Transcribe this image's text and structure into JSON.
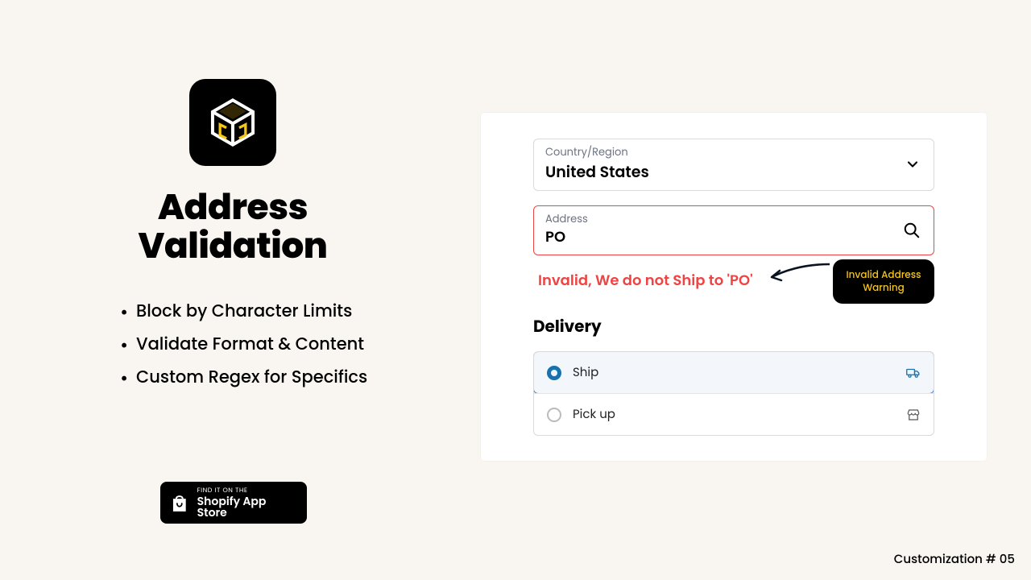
{
  "left": {
    "heading_line1": "Address",
    "heading_line2": "Validation",
    "features": [
      "Block by Character Limits",
      "Validate Format & Content",
      "Custom Regex for Specifics"
    ]
  },
  "store_badge": {
    "small": "FIND IT ON THE",
    "big": "Shopify App Store"
  },
  "form": {
    "country_label": "Country/Region",
    "country_value": "United States",
    "address_label": "Address",
    "address_value": "PO",
    "error_message": "Invalid, We do not Ship to 'PO'",
    "delivery_title": "Delivery",
    "options": [
      {
        "label": "Ship",
        "selected": true,
        "icon": "truck"
      },
      {
        "label": "Pick up",
        "selected": false,
        "icon": "store"
      }
    ]
  },
  "callout": {
    "line1": "Invalid Address",
    "line2": "Warning"
  },
  "footer": "Customization # 05",
  "colors": {
    "accent": "#f5c518",
    "error": "#ef4444",
    "blue": "#1773b0",
    "bg": "#f9f5f0"
  }
}
